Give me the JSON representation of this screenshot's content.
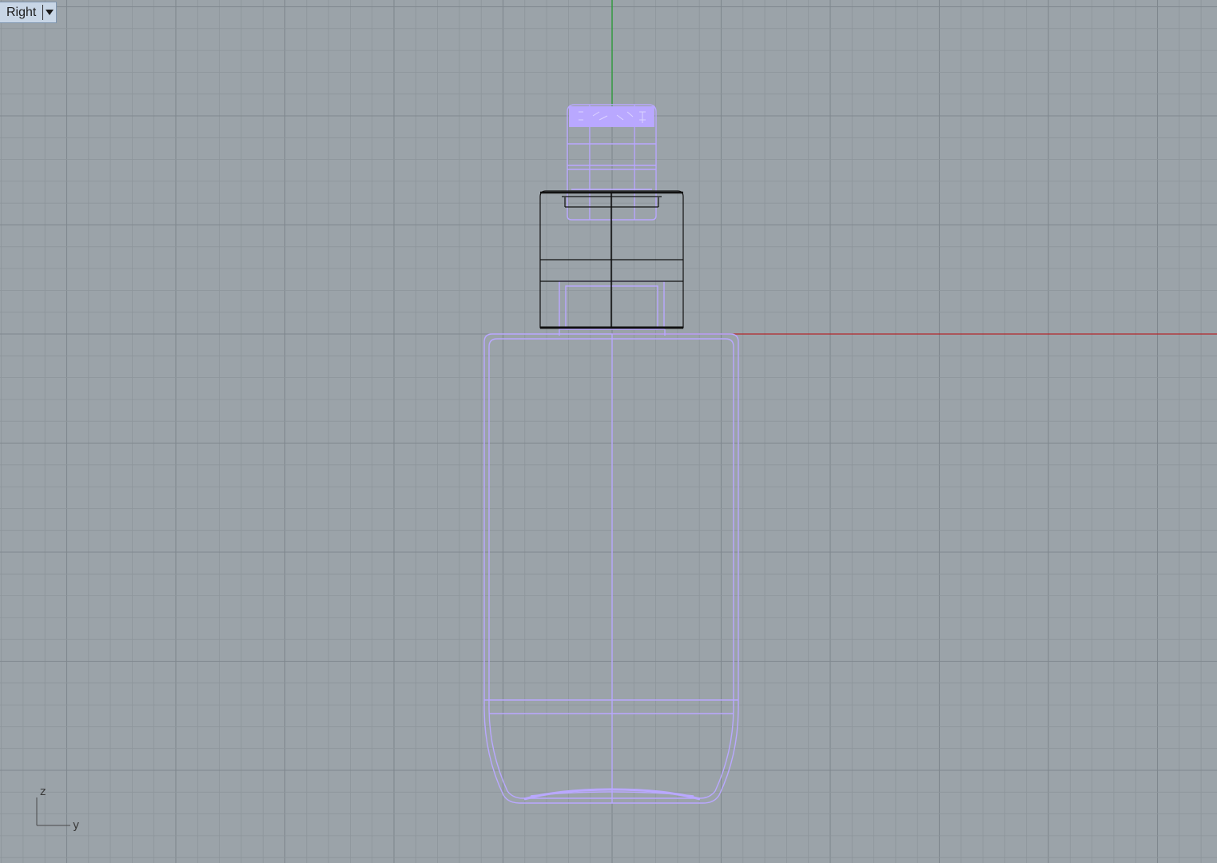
{
  "viewport": {
    "name": "Right",
    "dropdown_icon": "triangle-down-icon"
  },
  "axis_widget": {
    "vertical_label": "z",
    "horizontal_label": "y"
  },
  "colors": {
    "background": "#9ba3a9",
    "grid_minor": "#8d959b",
    "grid_major": "#7f878e",
    "x_axis": "#b3272b",
    "y_axis": "#2e9a3b",
    "selected_wire": "#b9a8ff",
    "object_wire": "#111111",
    "tab_bg": "#c8d6e6"
  }
}
